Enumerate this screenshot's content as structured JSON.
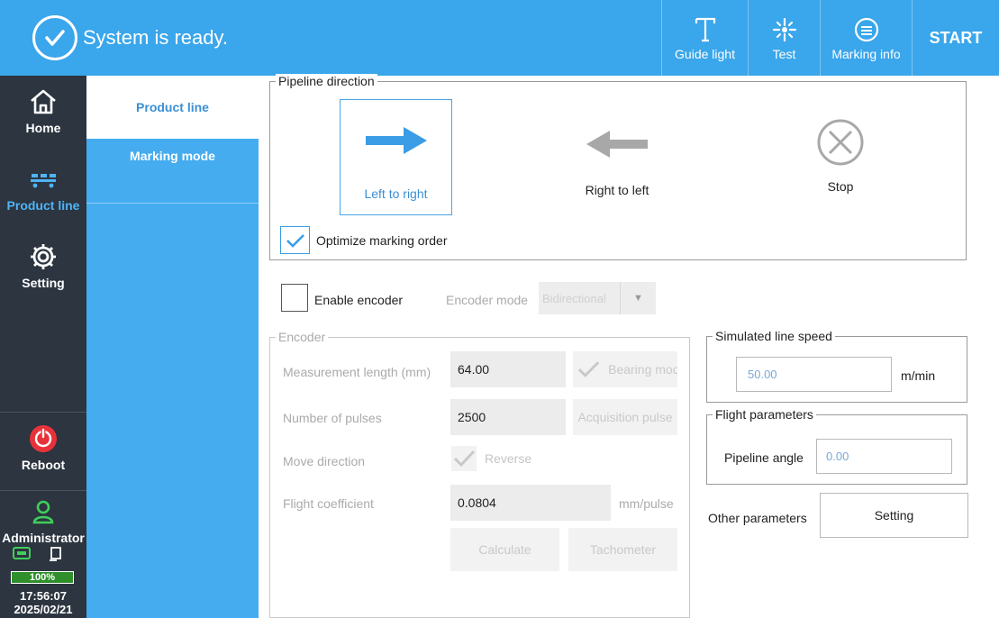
{
  "status": {
    "text": "System is ready."
  },
  "toolbar": {
    "guide_light": "Guide light",
    "test": "Test",
    "marking_info": "Marking info",
    "start": "START"
  },
  "nav": {
    "items": [
      {
        "label": "Home",
        "icon": "home-icon"
      },
      {
        "label": "Product line",
        "icon": "product-line-icon",
        "active": true
      },
      {
        "label": "Setting",
        "icon": "gear-icon"
      },
      {
        "label": "Reboot",
        "icon": "power-icon"
      },
      {
        "label": "Administrator",
        "icon": "user-icon"
      }
    ],
    "battery": "100%",
    "time": "17:56:07",
    "date": "2025/02/21"
  },
  "subnav": {
    "items": [
      {
        "label": "Product line",
        "active": true
      },
      {
        "label": "Marking mode",
        "active": false
      }
    ]
  },
  "pipeline": {
    "legend": "Pipeline direction",
    "left_to_right": "Left to right",
    "right_to_left": "Right to left",
    "stop": "Stop",
    "selected": "Left to right",
    "optimize_label": "Optimize marking order",
    "optimize_checked": true
  },
  "encoder_top": {
    "enable_label": "Enable encoder",
    "enable_checked": false,
    "mode_label": "Encoder mode",
    "mode_value": "Bidirectional"
  },
  "encoder": {
    "legend": "Encoder",
    "measurement_label": "Measurement length (mm)",
    "measurement_value": "64.00",
    "bearing_label": "Bearing mod",
    "pulses_label": "Number of pulses",
    "pulses_value": "2500",
    "acquisition_label": "Acquisition pulse",
    "move_label": "Move direction",
    "reverse_label": "Reverse",
    "flight_coef_label": "Flight coefficient",
    "flight_coef_value": "0.0804",
    "flight_coef_unit": "mm/pulse",
    "calculate_label": "Calculate",
    "tachometer_label": "Tachometer"
  },
  "sim_speed": {
    "legend": "Simulated line speed",
    "value": "50.00",
    "unit": "m/min"
  },
  "flight": {
    "legend": "Flight parameters",
    "angle_label": "Pipeline angle",
    "angle_value": "0.00"
  },
  "other": {
    "label": "Other parameters",
    "button": "Setting"
  },
  "colors": {
    "topbar": "#3aa6eb",
    "leftnav": "#2c3540",
    "subnav": "#45acf0",
    "accent": "#3a9de5"
  }
}
